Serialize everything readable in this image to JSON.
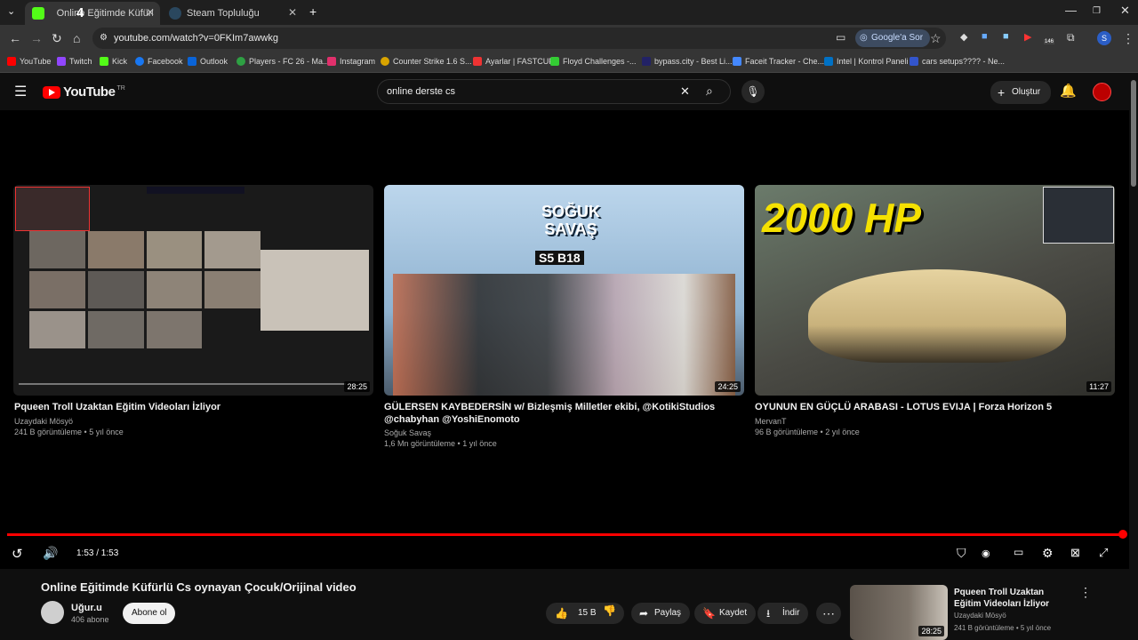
{
  "browser": {
    "tabs": [
      {
        "title": "Online Eğitimde Küfürlü Cs oy..."
      },
      {
        "title": "Steam Topluluğu"
      }
    ],
    "kick_badge": "4",
    "url": "youtube.com/watch?v=0FKIm7awwkg",
    "google_sor": "Google'a Sor",
    "ext_badge": "146",
    "profile_letter": "S",
    "bookmarks": [
      "YouTube",
      "Twitch",
      "Kick",
      "Facebook",
      "Outlook",
      "Players - FC 26 - Ma...",
      "Instagram",
      "Counter Strike 1.6 S...",
      "Ayarlar | FASTCUP",
      "Floyd Challenges -...",
      "bypass.city - Best Li...",
      "Faceit Tracker - Che...",
      "Intel | Kontrol Paneli",
      "cars setups???? - Ne..."
    ]
  },
  "youtube": {
    "logo": "YouTube",
    "region": "TR",
    "search_value": "online derste cs",
    "create_label": "Oluştur"
  },
  "endscreen": [
    {
      "title": "Pqueen Troll Uzaktan Eğitim Videoları İzliyor",
      "channel": "Uzaydaki Mösyö",
      "meta": "241 B görüntüleme • 5 yıl önce",
      "duration": "28:25"
    },
    {
      "title": "GÜLERSEN KAYBEDERSİN w/ Bizleşmiş Milletler ekibi, @KotikiStudios @chabyhan @YoshiEnomoto",
      "channel": "Soğuk Savaş",
      "meta": "1,6 Mn görüntüleme • 1 yıl önce",
      "duration": "24:25",
      "thumb_text": "SOĞUK SAVAŞ",
      "thumb_badge": "S5 B18"
    },
    {
      "title": "OYUNUN EN GÜÇLÜ ARABASI - LOTUS EVIJA | Forza Horizon 5",
      "channel": "MervanT",
      "meta": "96 B görüntüleme • 2 yıl önce",
      "duration": "11:27",
      "thumb_text": "2000 HP"
    }
  ],
  "player": {
    "time": "1:53 / 1:53",
    "progress": 1.0
  },
  "video": {
    "title": "Online Eğitimde Küfürlü Cs oynayan Çocuk/Orijinal video",
    "channel": "Uğur.u",
    "subscribers": "406 abone",
    "subscribe_label": "Abone ol",
    "likes": "15 B",
    "share_label": "Paylaş",
    "save_label": "Kaydet",
    "download_label": "İndir"
  },
  "sidebar_next": {
    "title": "Pqueen Troll Uzaktan Eğitim Videoları İzliyor",
    "channel": "Uzaydaki Mösyö",
    "meta": "241 B görüntüleme • 5 yıl önce",
    "duration": "28:25"
  }
}
